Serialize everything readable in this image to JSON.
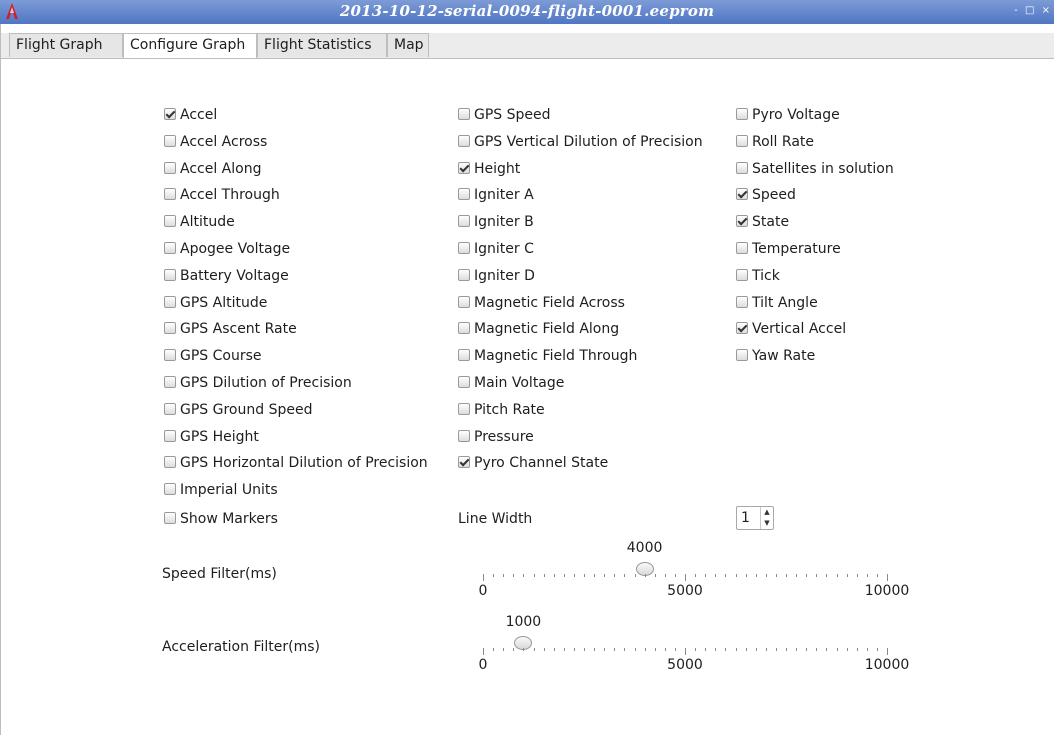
{
  "window": {
    "title": "2013-10-12-serial-0094-flight-0001.eeprom",
    "controls": [
      "-",
      "□",
      "×"
    ]
  },
  "tabs": [
    {
      "label": "Flight Graph",
      "active": false
    },
    {
      "label": "Configure Graph",
      "active": true
    },
    {
      "label": "Flight Statistics",
      "active": false
    },
    {
      "label": "Map",
      "active": false
    }
  ],
  "checkboxes": {
    "column1": [
      {
        "label": "Accel",
        "checked": true
      },
      {
        "label": "Accel Across",
        "checked": false
      },
      {
        "label": "Accel Along",
        "checked": false
      },
      {
        "label": "Accel Through",
        "checked": false
      },
      {
        "label": "Altitude",
        "checked": false
      },
      {
        "label": "Apogee Voltage",
        "checked": false
      },
      {
        "label": "Battery Voltage",
        "checked": false
      },
      {
        "label": "GPS Altitude",
        "checked": false
      },
      {
        "label": "GPS Ascent Rate",
        "checked": false
      },
      {
        "label": "GPS Course",
        "checked": false
      },
      {
        "label": "GPS Dilution of Precision",
        "checked": false
      },
      {
        "label": "GPS Ground Speed",
        "checked": false
      },
      {
        "label": "GPS Height",
        "checked": false
      },
      {
        "label": "GPS Horizontal Dilution of Precision",
        "checked": false
      },
      {
        "label": "Imperial Units",
        "checked": false
      }
    ],
    "column2": [
      {
        "label": "GPS Speed",
        "checked": false
      },
      {
        "label": "GPS Vertical Dilution of Precision",
        "checked": false
      },
      {
        "label": "Height",
        "checked": true
      },
      {
        "label": "Igniter A",
        "checked": false
      },
      {
        "label": "Igniter B",
        "checked": false
      },
      {
        "label": "Igniter C",
        "checked": false
      },
      {
        "label": "Igniter D",
        "checked": false
      },
      {
        "label": "Magnetic Field Across",
        "checked": false
      },
      {
        "label": "Magnetic Field Along",
        "checked": false
      },
      {
        "label": "Magnetic Field Through",
        "checked": false
      },
      {
        "label": "Main Voltage",
        "checked": false
      },
      {
        "label": "Pitch Rate",
        "checked": false
      },
      {
        "label": "Pressure",
        "checked": false
      },
      {
        "label": "Pyro Channel State",
        "checked": true
      }
    ],
    "column3": [
      {
        "label": "Pyro Voltage",
        "checked": false
      },
      {
        "label": "Roll Rate",
        "checked": false
      },
      {
        "label": "Satellites in solution",
        "checked": false
      },
      {
        "label": "Speed",
        "checked": true
      },
      {
        "label": "State",
        "checked": true
      },
      {
        "label": "Temperature",
        "checked": false
      },
      {
        "label": "Tick",
        "checked": false
      },
      {
        "label": "Tilt Angle",
        "checked": false
      },
      {
        "label": "Vertical Accel",
        "checked": true
      },
      {
        "label": "Yaw Rate",
        "checked": false
      }
    ]
  },
  "show_markers": {
    "label": "Show Markers",
    "checked": false
  },
  "line_width": {
    "label": "Line Width",
    "value": "1",
    "up_glyph": "▲",
    "down_glyph": "▼"
  },
  "speed_filter": {
    "label": "Speed Filter(ms)",
    "value": 4000,
    "value_text": "4000",
    "min": 0,
    "max": 10000,
    "tick_labels": [
      "0",
      "5000",
      "10000"
    ]
  },
  "accel_filter": {
    "label": "Acceleration Filter(ms)",
    "value": 1000,
    "value_text": "1000",
    "min": 0,
    "max": 10000,
    "tick_labels": [
      "0",
      "5000",
      "10000"
    ]
  }
}
